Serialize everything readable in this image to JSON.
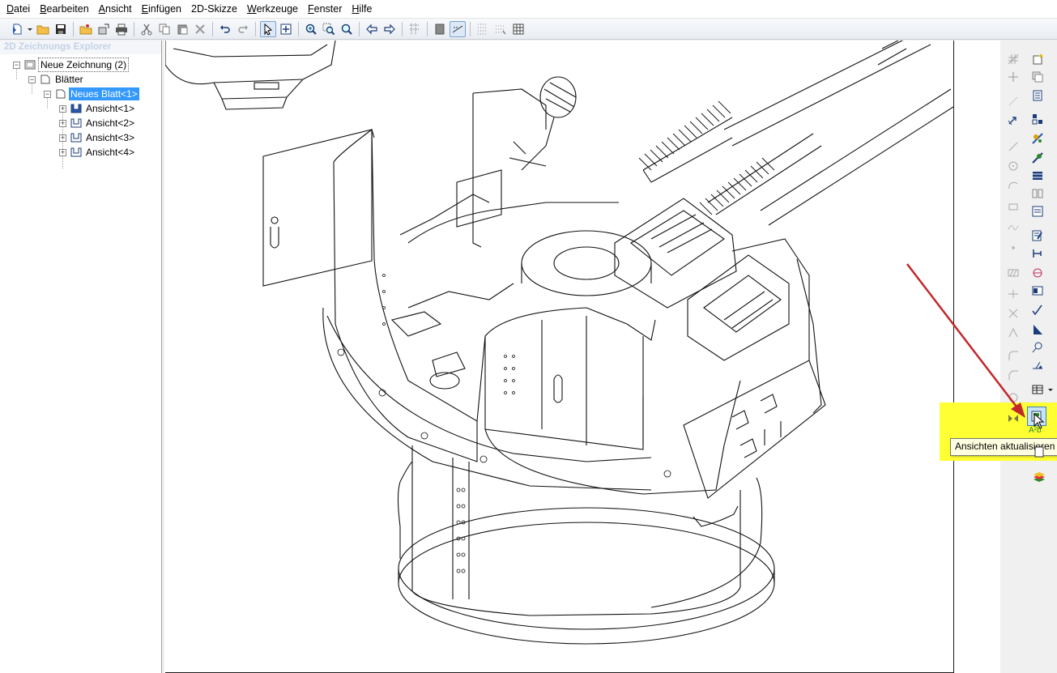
{
  "menubar": {
    "items": [
      {
        "acc": "D",
        "rest": "atei"
      },
      {
        "acc": "B",
        "rest": "earbeiten"
      },
      {
        "acc": "A",
        "rest": "nsicht"
      },
      {
        "acc": "E",
        "rest": "infügen"
      },
      {
        "acc": "",
        "rest": "2D-Skizze"
      },
      {
        "acc": "W",
        "rest": "erkzeuge"
      },
      {
        "acc": "F",
        "rest": "enster"
      },
      {
        "acc": "H",
        "rest": "ilfe"
      }
    ]
  },
  "explorer": {
    "title": "2D Zeichnungs Explorer",
    "tree": {
      "root": "Neue Zeichnung (2)",
      "sheets_folder": "Blätter",
      "sheet": "Neues Blatt<1>",
      "views": [
        "Ansicht<1>",
        "Ansicht<2>",
        "Ansicht<3>",
        "Ansicht<4>"
      ]
    }
  },
  "tooltip": {
    "text": "Ansichten aktualisieren"
  },
  "colors": {
    "highlight": "#ffff33",
    "selection": "#3399ff",
    "annotation_arrow": "#c0282a",
    "tooltip_bg": "#ffffe1"
  }
}
